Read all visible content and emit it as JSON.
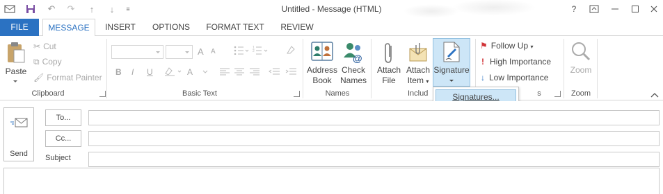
{
  "window": {
    "title": "Untitled - Message (HTML)",
    "help": "?"
  },
  "tabs": [
    {
      "label": "FILE"
    },
    {
      "label": "MESSAGE"
    },
    {
      "label": "INSERT"
    },
    {
      "label": "OPTIONS"
    },
    {
      "label": "FORMAT TEXT"
    },
    {
      "label": "REVIEW"
    }
  ],
  "clipboard": {
    "paste": "Paste",
    "cut": "Cut",
    "copy": "Copy",
    "format_painter": "Format Painter",
    "group": "Clipboard"
  },
  "basic_text": {
    "bold": "B",
    "italic": "I",
    "underline": "U",
    "grow": "A",
    "shrink": "A",
    "font_color": "A",
    "group": "Basic Text"
  },
  "names": {
    "address_book": [
      "Address",
      "Book"
    ],
    "check_names": [
      "Check",
      "Names"
    ],
    "group": "Names"
  },
  "include": {
    "attach_file": [
      "Attach",
      "File"
    ],
    "attach_item": [
      "Attach",
      "Item"
    ],
    "signature": "Signature",
    "group": "Includ"
  },
  "tags": {
    "follow_up": "Follow Up",
    "high": "High Importance",
    "low": "Low Importance",
    "group": "s"
  },
  "zoom": {
    "zoom": "Zoom",
    "group": "Zoom"
  },
  "signature_menu": {
    "item": "Signatures..."
  },
  "compose": {
    "send": "Send",
    "to": "To...",
    "cc": "Cc...",
    "subject": "Subject"
  },
  "colors": {
    "accent": "#2b72c2",
    "highlight": "#cde6f7",
    "flag": "#d13438"
  }
}
